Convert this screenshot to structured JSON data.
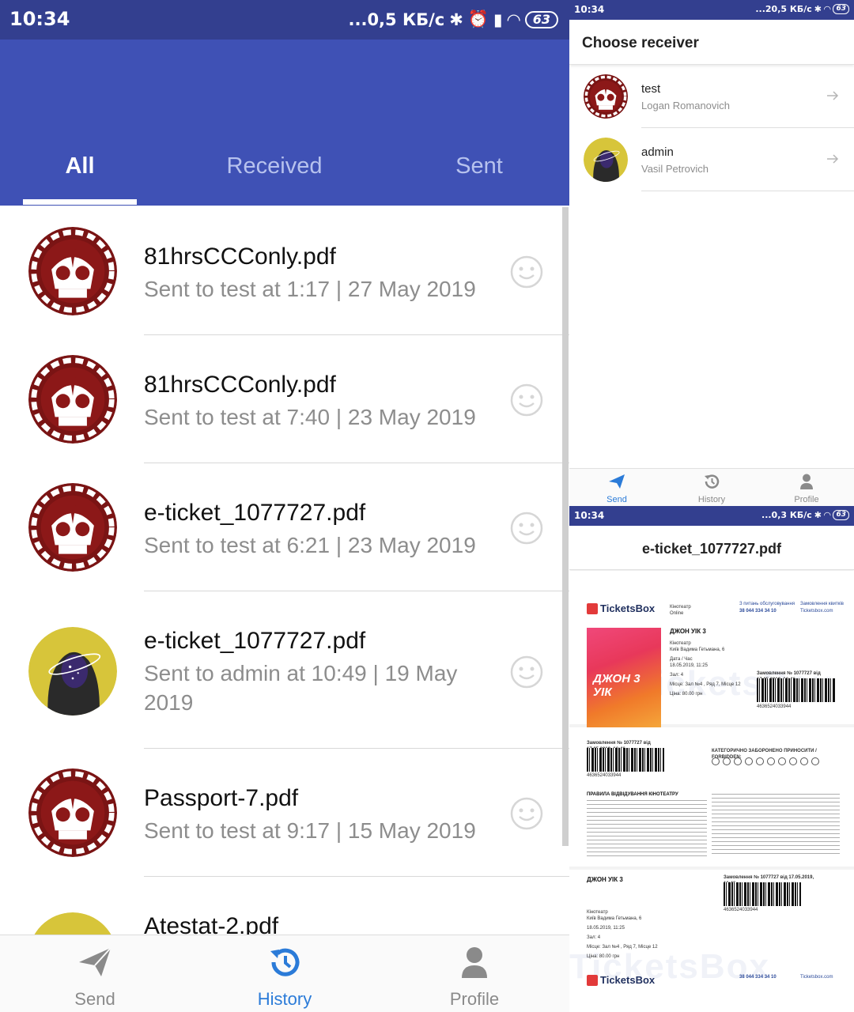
{
  "history_screen": {
    "status": {
      "time": "10:34",
      "speed": "...0,5 КБ/с",
      "battery": "63"
    },
    "tabs": [
      {
        "label": "All"
      },
      {
        "label": "Received"
      },
      {
        "label": "Sent"
      }
    ],
    "items": [
      {
        "title": "81hrsCCConly.pdf",
        "subtitle": "Sent to test at 1:17 | 27 May 2019",
        "avatar": "skull-gear-avatar"
      },
      {
        "title": "81hrsCCConly.pdf",
        "subtitle": "Sent to test at 7:40 | 23 May 2019",
        "avatar": "skull-gear-avatar"
      },
      {
        "title": "e-ticket_1077727.pdf",
        "subtitle": "Sent to test at 6:21 | 23 May 2019",
        "avatar": "skull-gear-avatar"
      },
      {
        "title": "e-ticket_1077727.pdf",
        "subtitle": "Sent to admin at 10:49 | 19 May 2019",
        "avatar": "hooded-figure-avatar"
      },
      {
        "title": "Passport-7.pdf",
        "subtitle": "Sent to test at 9:17 | 15 May 2019",
        "avatar": "skull-gear-avatar"
      },
      {
        "title": "Atestat-2.pdf",
        "subtitle": "",
        "avatar": "hooded-figure-avatar"
      }
    ],
    "nav": [
      {
        "label": "Send",
        "icon": "send-icon"
      },
      {
        "label": "History",
        "icon": "history-icon"
      },
      {
        "label": "Profile",
        "icon": "profile-icon"
      }
    ]
  },
  "receiver_screen": {
    "status": {
      "time": "10:34",
      "speed": "...20,5 КБ/с",
      "battery": "63"
    },
    "title": "Choose receiver",
    "receivers": [
      {
        "name": "test",
        "full_name": "Logan Romanovich"
      },
      {
        "name": "admin",
        "full_name": "Vasil Petrovich"
      }
    ],
    "nav": [
      {
        "label": "Send"
      },
      {
        "label": "History"
      },
      {
        "label": "Profile"
      }
    ]
  },
  "document_screen": {
    "status": {
      "time": "10:34",
      "speed": "...0,3 КБ/с",
      "battery": "63"
    },
    "title": "e-ticket_1077727.pdf",
    "ticket": {
      "brand": "TicketsBox",
      "brand_sub": "Кінотеатр Online",
      "phone_label": "З питань обслуговування",
      "phone": "38 044 334 34 10",
      "site_label": "Замовлення квитків",
      "site": "Ticketsbox.com",
      "movie": "ДЖОН УІК 3",
      "poster_text": "ДЖОН 3 УІК",
      "cinema_label": "Кінотеатр",
      "cinema": "Київ Вадима Гетьмана, 6",
      "date_label": "Дата / Час",
      "date": "18.05.2019, 11:25",
      "hall": "Зал: 4",
      "seat": "Місце: Зал №4 , Ряд 7, Місце 12",
      "price": "Ціна: 80.00 грн",
      "order": "Замовлення № 1077727 від 17.05.2019, 16:46",
      "barcode_number": "4636524033944",
      "forbidden_label": "КАТЕГОРИЧНО ЗАБОРОНЕНО ПРИНОСИТИ / FORBIDDEN:",
      "rules_label": "ПРАВИЛА ВІДВІДУВАННЯ КІНОТЕАТРУ"
    }
  },
  "colors": {
    "app_bar": "#3f51b5",
    "status_bar": "#333f8f",
    "accent": "#2b7bd8",
    "avatar_red": "#7a1414"
  }
}
